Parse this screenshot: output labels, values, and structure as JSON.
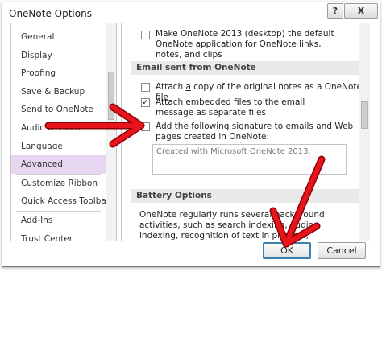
{
  "window": {
    "title": "OneNote Options",
    "help_label": "?",
    "close_label": "X"
  },
  "sidebar": {
    "items": [
      {
        "label": "General"
      },
      {
        "label": "Display"
      },
      {
        "label": "Proofing"
      },
      {
        "label": "Save & Backup"
      },
      {
        "label": "Send to OneNote"
      },
      {
        "label": "Audio & Video"
      },
      {
        "label": "Language"
      },
      {
        "label": "Advanced"
      },
      {
        "label": "Customize Ribbon"
      },
      {
        "label": "Quick Access Toolbar"
      },
      {
        "label": "Add-Ins"
      },
      {
        "label": "Trust Center"
      }
    ],
    "active_item": "Advanced"
  },
  "content": {
    "make_default": {
      "checked": false,
      "text": "Make OneNote 2013 (desktop) the default OneNote application for OneNote links, notes, and clips"
    },
    "email_section": {
      "header": "Email sent from OneNote"
    },
    "attach_copy": {
      "checked": false,
      "text_pre": "Attach ",
      "text_underlined": "a",
      "text_post": " copy of the original notes as a OneNote file"
    },
    "attach_embedded": {
      "checked": true,
      "text": "Attach embedded files to the email message as separate files"
    },
    "add_signature": {
      "checked": false,
      "text": "Add the following signature to emails and Web pages created in OneNote:"
    },
    "signature_value": "Created with Microsoft OneNote 2013.",
    "battery_section": {
      "header": "Battery Options"
    },
    "battery_text": "OneNote regularly runs several background activities, such as search indexing, audio indexing, recognition of text in pictures, handwriting recognition, and notebook"
  },
  "buttons": {
    "ok": "OK",
    "cancel": "Cancel"
  },
  "annotation_color": "#e8141c"
}
